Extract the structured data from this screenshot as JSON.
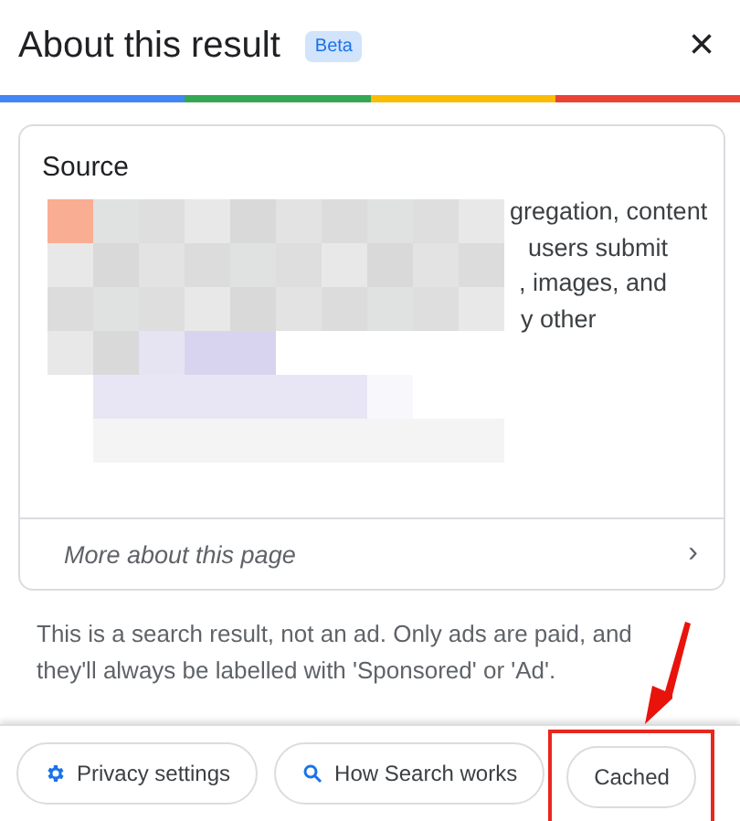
{
  "header": {
    "title": "About this result",
    "badge": "Beta",
    "close": "×"
  },
  "source_card": {
    "title": "Source",
    "text_lines": [
      "gregation, content",
      "users submit",
      ", images, and",
      "y other"
    ],
    "link": "More about this page",
    "link_arrow": "›"
  },
  "notice": "This is a search result, not an ad. Only ads are paid, and they'll always be labelled with 'Sponsored' or 'Ad'.",
  "buttons": [
    {
      "label": "Privacy settings",
      "kind": "settings",
      "highlighted": false
    },
    {
      "label": "How Search works",
      "kind": "search",
      "highlighted": false
    },
    {
      "label": "Cached",
      "kind": "plain",
      "highlighted": true
    }
  ]
}
